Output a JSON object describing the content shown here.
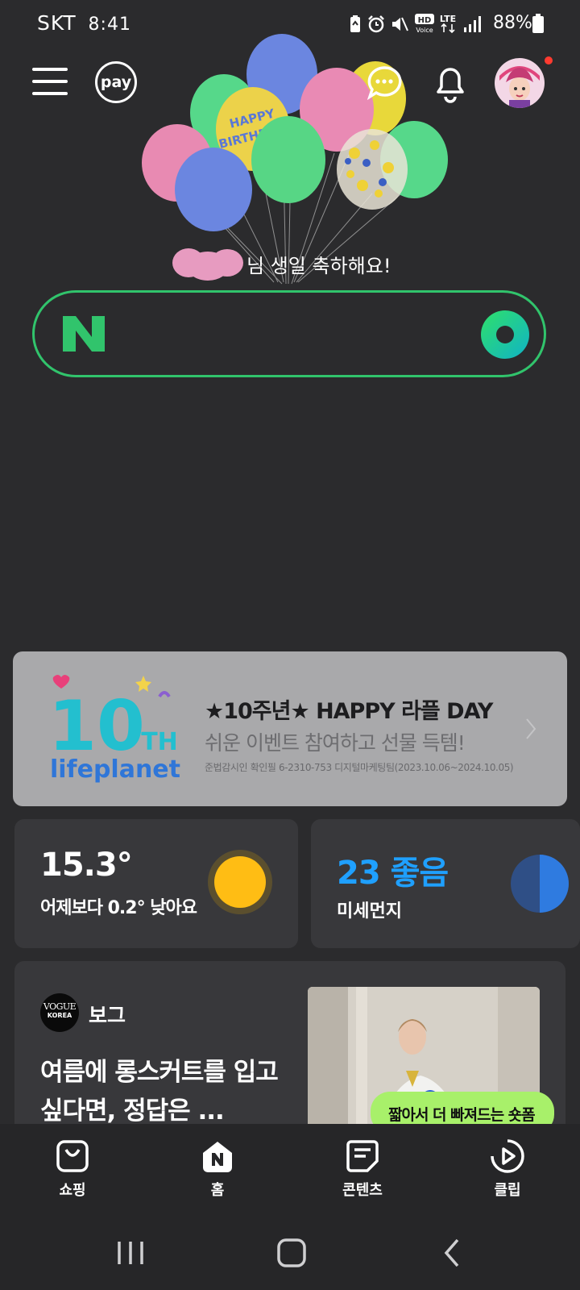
{
  "status_bar": {
    "carrier": "SKT",
    "time": "8:41",
    "battery_percent": "88%",
    "icons": [
      "battery-saver-icon",
      "alarm-icon",
      "mute-icon",
      "hd-voice-icon",
      "lte-icon",
      "signal-icon",
      "battery-icon"
    ]
  },
  "top_bar": {
    "pay_label": "pay",
    "greeting_suffix": "님 생일 축하해요!"
  },
  "search": {
    "logo": "N",
    "accent_color": "#31c46c"
  },
  "banner": {
    "logo_number": "10",
    "logo_suffix": "TH",
    "logo_brand": "lifeplanet",
    "title": "★10주년★ HAPPY 라플 DAY",
    "subtitle": "쉬운 이벤트 참여하고 선물 득템!",
    "legal": "준법감시인 확인필 6-2310-753 디지털마케팅팀(2023.10.06~2024.10.05)"
  },
  "weather": {
    "temperature": "15.3°",
    "compare": "어제보다 0.2° 낮아요"
  },
  "dust": {
    "value": "23 좋음",
    "label": "미세먼지",
    "color": "#1fa0ff"
  },
  "article": {
    "source_logo_line1": "VOGUE",
    "source_logo_line2": "KOREA",
    "source_name": "보그",
    "title": "여름에 롱스커트를 입고 싶다면, 정답은 ...",
    "shorts_badge": "짧아서 더 빠져드는 숏폼"
  },
  "bottom_nav": {
    "items": [
      {
        "label": "쇼핑",
        "icon": "shopping-bag-icon"
      },
      {
        "label": "홈",
        "icon": "naver-home-icon"
      },
      {
        "label": "콘텐츠",
        "icon": "contents-icon"
      },
      {
        "label": "클립",
        "icon": "clip-play-icon"
      }
    ]
  },
  "system_nav": [
    "recent-apps-icon",
    "home-icon",
    "back-icon"
  ]
}
